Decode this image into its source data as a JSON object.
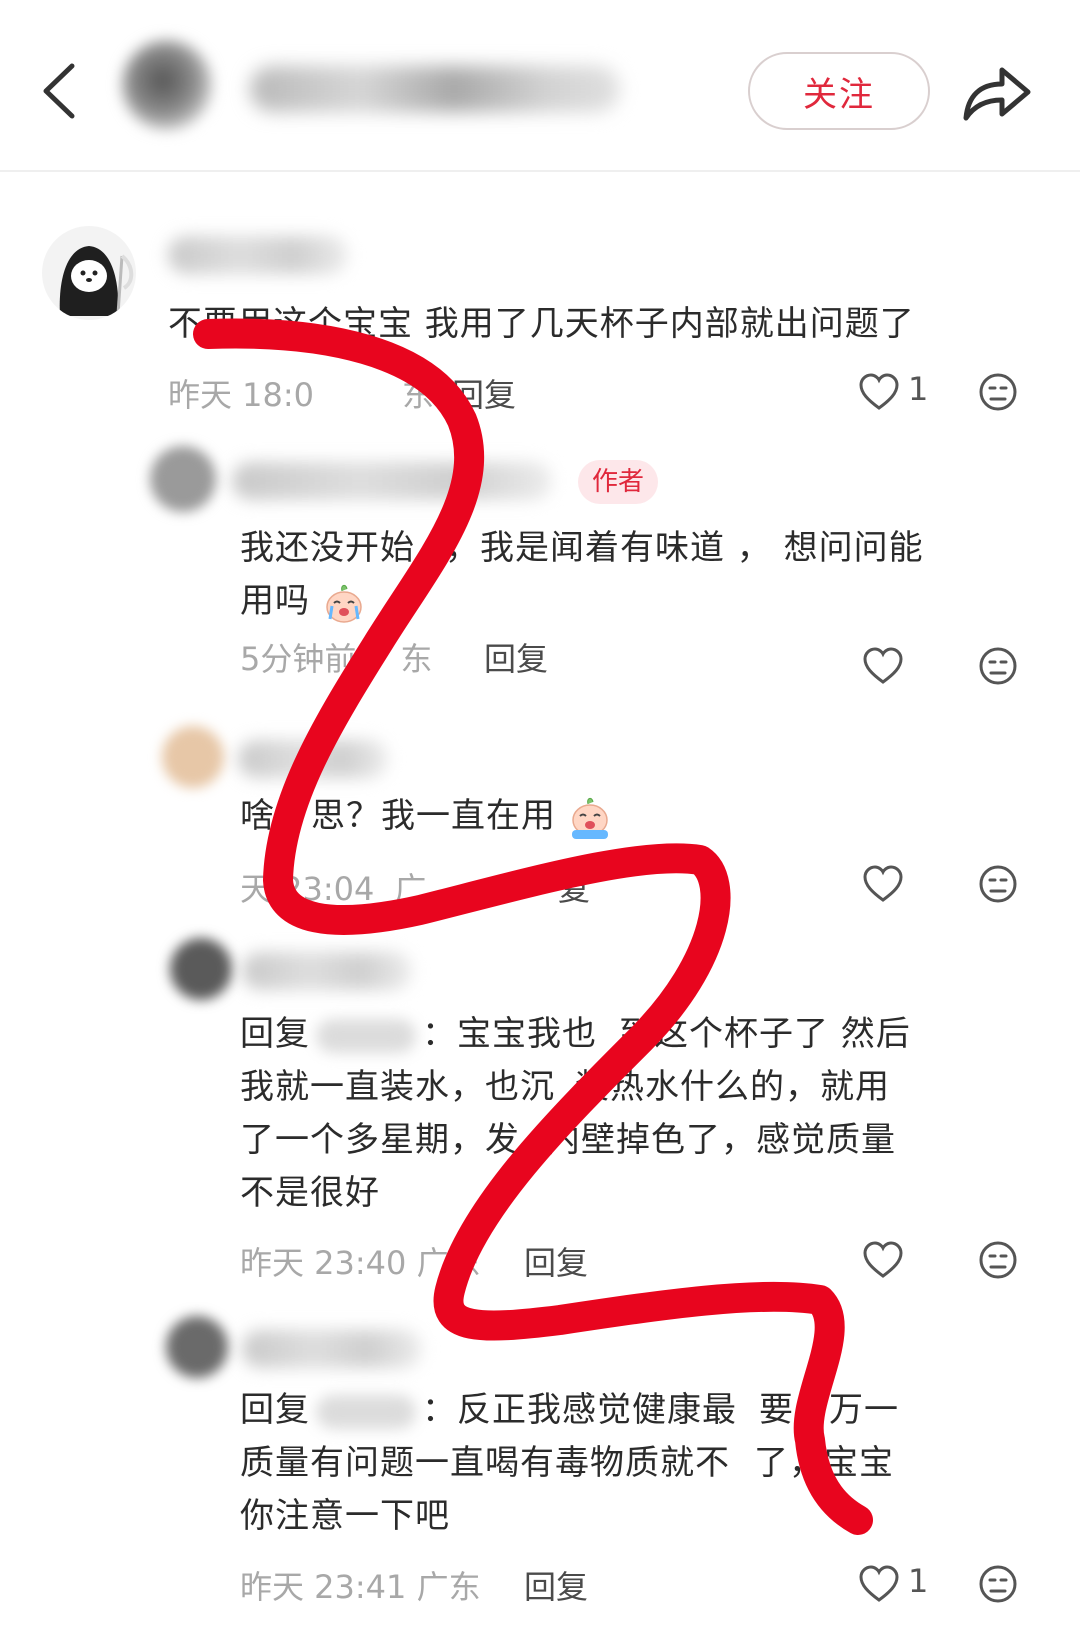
{
  "header": {
    "follow_label": "关注"
  },
  "colors": {
    "accent": "#e0283c",
    "badge_bg": "#fde7ea",
    "meta_text": "#a8a8a8",
    "scribble": "#e8051e"
  },
  "icons": {
    "back": "chevron-left-icon",
    "share": "share-arrow-icon",
    "like": "heart-outline-icon",
    "dislike": "neutral-face-icon"
  },
  "comments": [
    {
      "text": "不要用这个宝宝 我用了几天杯子内部就出问题了",
      "time": "昨天 18:0",
      "location": "东",
      "reply_label": "回复",
      "likes": "1"
    },
    {
      "badge": "作者",
      "text_line1": "我还没开始",
      "text_line1b": "，我是闻着有味道 ， 想问问能",
      "text_line2": "用吗",
      "time": "5分钟前",
      "location": "东",
      "reply_label": "回复"
    },
    {
      "text_a": "啥",
      "text_b": "思？我一直在用",
      "time": "天 23:04",
      "location": "广",
      "reply_label": "复"
    },
    {
      "prefix": "回复",
      "colon": "：",
      "line1": "宝宝我也",
      "line1b": "到这个杯子了 然后",
      "line2a": "我就一直装水，也沉",
      "line2b": "装热水什么的，就用",
      "line3a": "了一个多星期，发",
      "line3b": "内壁掉色了，感觉质量",
      "line4": "不是很好",
      "time": "昨天 23:40 广东",
      "reply_label": "回复"
    },
    {
      "prefix": "回复",
      "colon": "：",
      "line1a": "反正我感觉健康最",
      "line1b": "要，万一",
      "line2a": "质量有问题一直喝有毒物质就不",
      "line2b": "了，宝宝",
      "line3": "你注意一下吧",
      "time": "昨天 23:41 广东",
      "reply_label": "回复",
      "likes": "1"
    }
  ]
}
